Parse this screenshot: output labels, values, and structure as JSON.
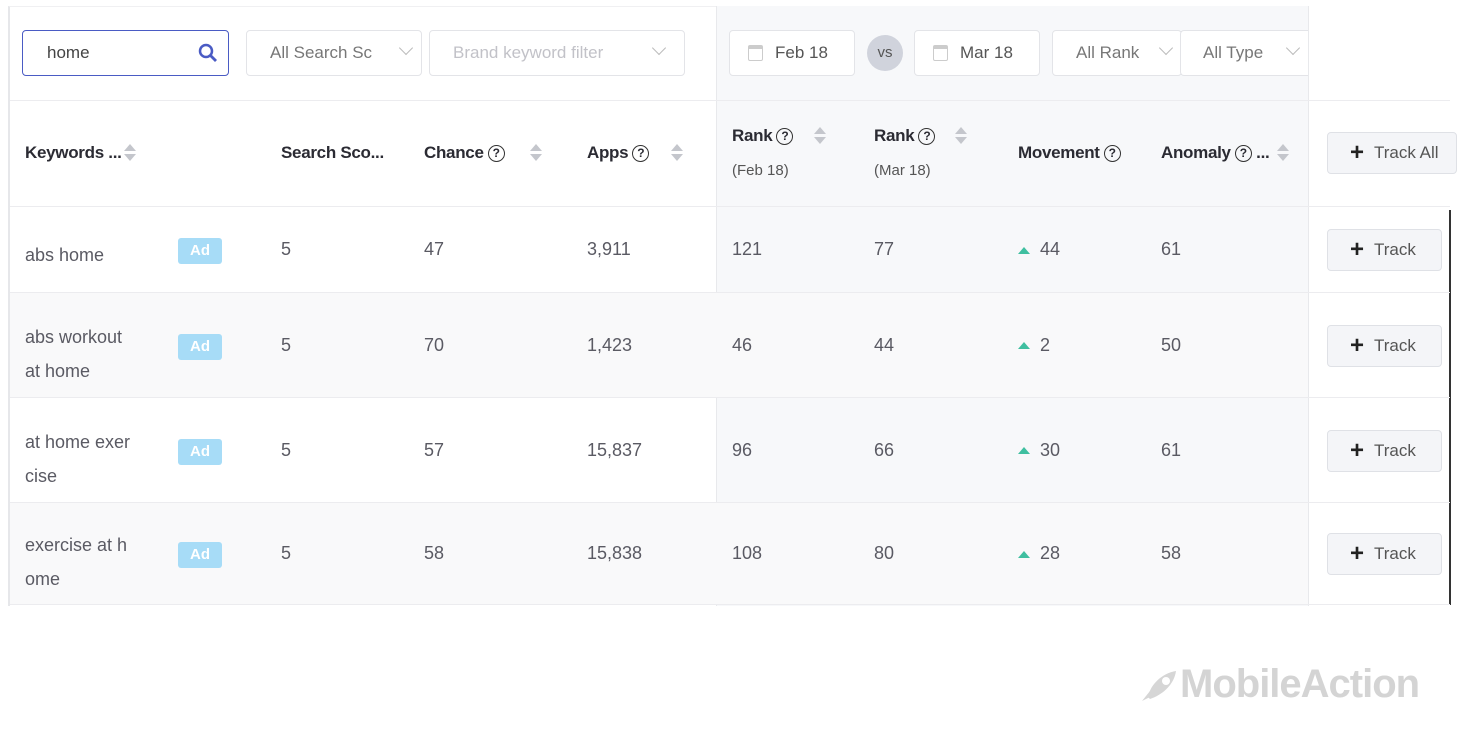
{
  "toolbar": {
    "search_value": "home",
    "search_score_filter": "All Search Sc",
    "brand_filter_placeholder": "Brand keyword filter",
    "date_from": "Feb 18",
    "vs": "vs",
    "date_to": "Mar 18",
    "rank_filter": "All Rank",
    "type_filter": "All Type"
  },
  "headers": {
    "keywords": "Keywords ...",
    "search_score": "Search Sco...",
    "chance": "Chance",
    "apps": "Apps",
    "rank1": "Rank",
    "rank1_sub": "(Feb 18)",
    "rank2": "Rank",
    "rank2_sub": "(Mar 18)",
    "movement": "Movement",
    "anomaly": "Anomaly",
    "anomaly_more": "...",
    "track_all": "Track All",
    "help": "?"
  },
  "rows": [
    {
      "kw1": "abs home",
      "kw2": "",
      "ad": "Ad",
      "score": "5",
      "chance": "47",
      "apps": "3,911",
      "rank1": "121",
      "rank2": "77",
      "movement": "44",
      "anomaly": "61",
      "track": "Track"
    },
    {
      "kw1": "abs workout",
      "kw2": "at home",
      "ad": "Ad",
      "score": "5",
      "chance": "70",
      "apps": "1,423",
      "rank1": "46",
      "rank2": "44",
      "movement": "2",
      "anomaly": "50",
      "track": "Track"
    },
    {
      "kw1": "at home exer",
      "kw2": "cise",
      "ad": "Ad",
      "score": "5",
      "chance": "57",
      "apps": "15,837",
      "rank1": "96",
      "rank2": "66",
      "movement": "30",
      "anomaly": "61",
      "track": "Track"
    },
    {
      "kw1": "exercise at h",
      "kw2": "ome",
      "ad": "Ad",
      "score": "5",
      "chance": "58",
      "apps": "15,838",
      "rank1": "108",
      "rank2": "80",
      "movement": "28",
      "anomaly": "58",
      "track": "Track"
    }
  ],
  "colors": {
    "accent": "#4a5bc4",
    "movement_up": "#3fbfa0",
    "ad_badge": "#a7dcf7"
  },
  "logo": "MobileAction"
}
